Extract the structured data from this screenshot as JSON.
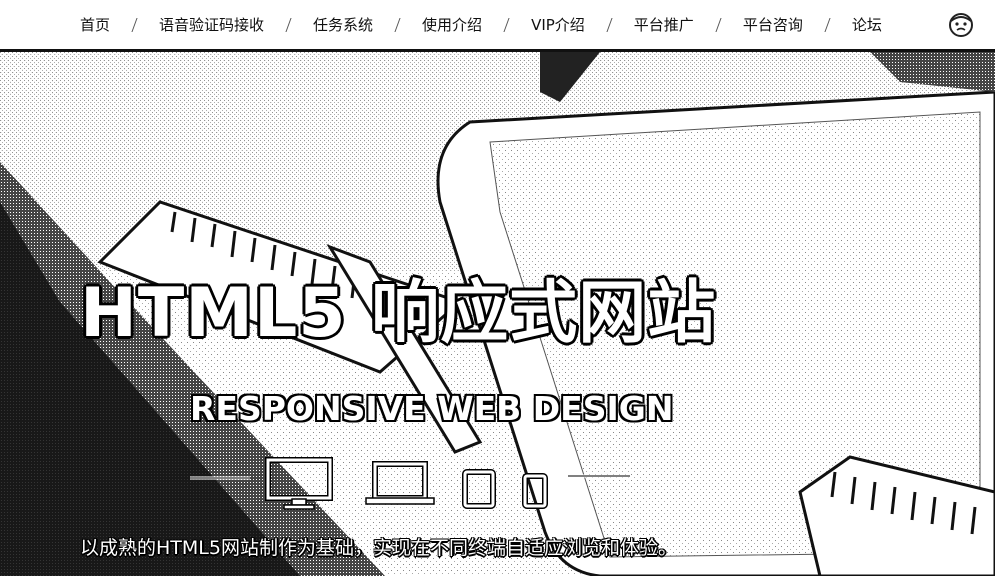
{
  "nav": {
    "items": [
      {
        "label": "首页"
      },
      {
        "label": "语音验证码接收"
      },
      {
        "label": "任务系统"
      },
      {
        "label": "使用介绍"
      },
      {
        "label": "VIP介绍"
      },
      {
        "label": "平台推广"
      },
      {
        "label": "平台咨询"
      },
      {
        "label": "论坛"
      }
    ],
    "user_icon": "user-avatar-icon"
  },
  "hero": {
    "title": "HTML5 响应式网站",
    "subtitle": "RESPONSIVE WEB DESIGN",
    "description": "以成熟的HTML5网站制作为基础，实现在不同终端自适应浏览和体验。",
    "device_icons": [
      "desktop-icon",
      "laptop-icon",
      "tablet-icon",
      "phone-icon"
    ]
  }
}
